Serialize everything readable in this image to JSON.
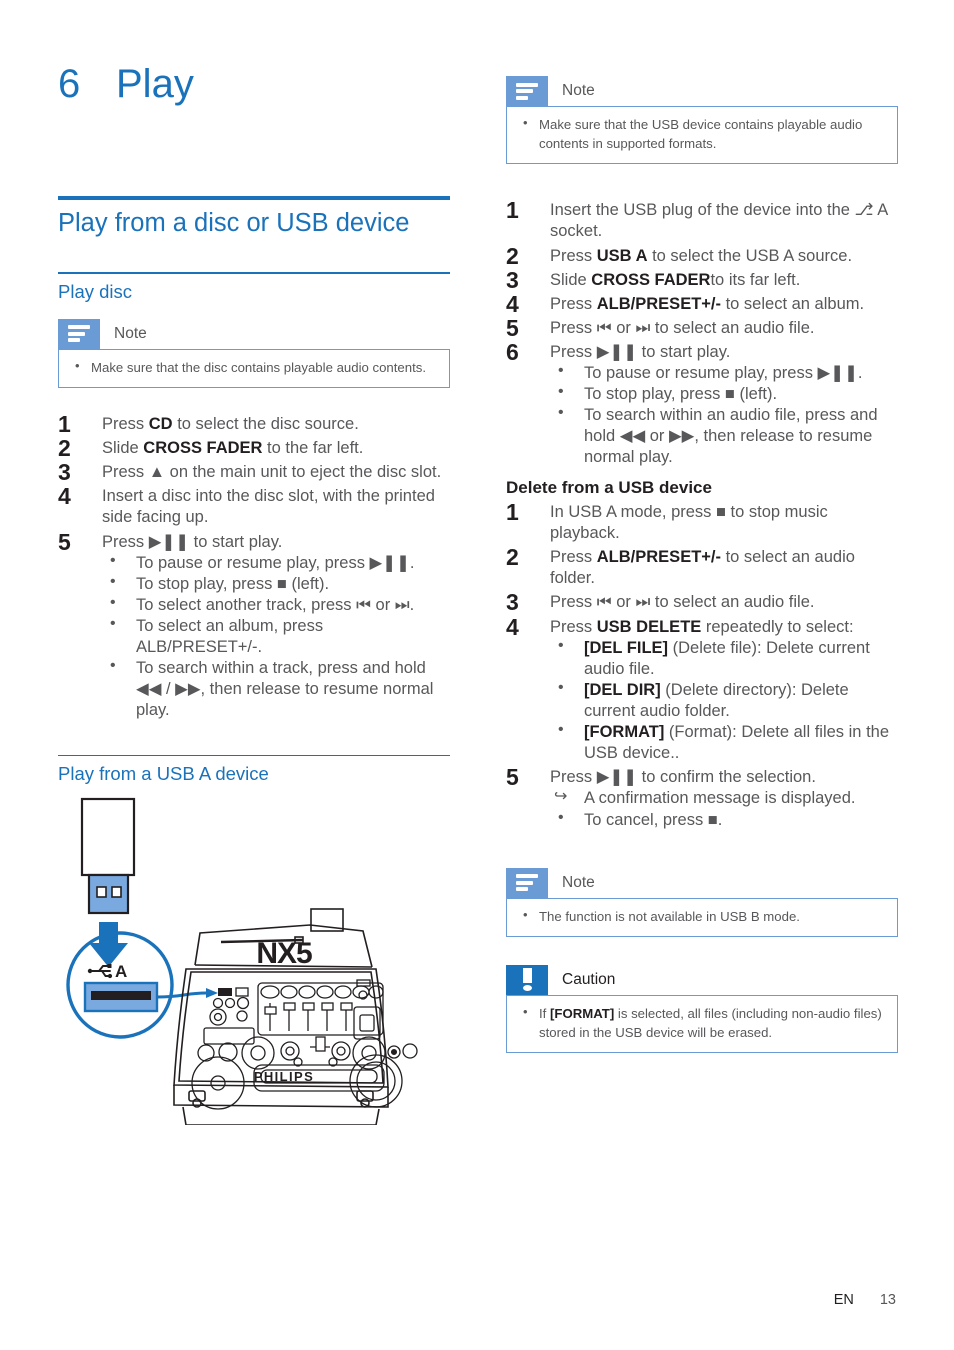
{
  "chapter": {
    "number": "6",
    "title": "Play"
  },
  "left": {
    "section_heading": "Play from a disc or USB device",
    "sub_heading_1": "Play disc",
    "note_disc": {
      "title": "Note",
      "items": [
        "Make sure that the disc contains playable audio contents."
      ]
    },
    "disc_steps": [
      {
        "text_before": "Press ",
        "bold": "CD",
        "text_after": " to select the disc source."
      },
      {
        "text_before": "Slide ",
        "bold": "CROSS FADER",
        "text_after": " to the far left."
      },
      {
        "text_before": "Press ▲ on the main unit to eject the disc slot.",
        "bold": "",
        "text_after": ""
      },
      {
        "text_before": "Insert a disc into the disc slot, with the printed side facing up.",
        "bold": "",
        "text_after": ""
      },
      {
        "text_before": "Press ▶❚❚ to start play.",
        "bold": "",
        "text_after": ""
      }
    ],
    "disc_substeps": [
      "To pause or resume play, press ▶❚❚.",
      "To stop play, press ■ (left).",
      "To select another track, press ⏮ or ⏭.",
      "To select an album, press ALB/PRESET+/-.",
      "To search within a track, press and hold ◀◀ / ▶▶, then release to resume normal play."
    ],
    "sub_heading_2": "Play from a USB A device",
    "illustration": {
      "device_model": "NX5",
      "brand": "PHILIPS",
      "socket_label": "A",
      "socket_icon": "usb-icon"
    }
  },
  "right": {
    "note_usb": {
      "title": "Note",
      "items": [
        "Make sure that the USB device contains playable audio contents in supported formats."
      ]
    },
    "usb_steps": [
      "Insert the USB plug of the device into the ⎇ A socket.",
      "Press USB A to select the USB A source.",
      "Slide CROSS FADERto its far left.",
      "Press ALB/PRESET+/- to select an album.",
      "Press ⏮ or ⏭ to select an audio file.",
      "Press ▶❚❚ to start play."
    ],
    "usb_substeps": [
      "To pause or resume play, press ▶❚❚.",
      "To stop play, press ■ (left).",
      "To search within an audio file, press and hold ◀◀ or ▶▶, then release to resume normal play."
    ],
    "delete_heading": "Delete from a USB device",
    "delete_steps": [
      "In USB A mode, press ■ to stop music playback.",
      "Press ALB/PRESET+/- to select an audio folder.",
      "Press ⏮ or ⏭ to select an audio file.",
      "Press USB DELETE repeatedly to select:",
      "Press ▶❚❚ to confirm the selection."
    ],
    "delete_options": [
      {
        "label": "[DEL FILE]",
        "desc": " (Delete file): Delete current audio file."
      },
      {
        "label": "[DEL DIR]",
        "desc": " (Delete directory): Delete current audio folder."
      },
      {
        "label": "[FORMAT]",
        "desc": " (Format): Delete all files in the USB device.."
      }
    ],
    "confirm_result": "A confirmation message is displayed.",
    "cancel_note": "To cancel, press ■.",
    "note_usbb": {
      "title": "Note",
      "items": [
        "The function is not available in USB B mode."
      ]
    },
    "caution": {
      "title": "Caution",
      "prefix": "If ",
      "bold": "[FORMAT]",
      "suffix": " is selected, all files (including non-audio files) stored in the USB device will be erased."
    }
  },
  "footer": {
    "language": "EN",
    "page": "13"
  },
  "colors": {
    "accent": "#1a72bb",
    "note_badge": "#6b9bd5",
    "text": "#58585b",
    "heading_dark": "#231f20"
  }
}
